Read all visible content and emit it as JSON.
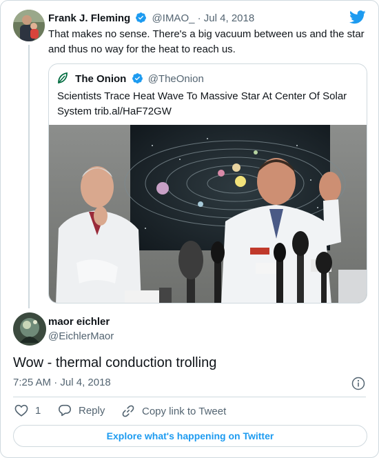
{
  "parent_tweet": {
    "author_name": "Frank J. Fleming",
    "handle": "@IMAO_",
    "separator": "·",
    "date": "Jul 4, 2018",
    "text": "That makes no sense. There's a big vacuum between us and the star and thus no way for the heat to reach us.",
    "avatar_icon": "person-with-child-photo"
  },
  "quoted_tweet": {
    "author_name": "The Onion",
    "handle": "@TheOnion",
    "text": "Scientists Trace Heat Wave To Massive Star At Center Of Solar System trib.al/HaF72GW",
    "logo_icon": "onion-leaf-icon",
    "image_description_icon": "scientists-press-conference-photo"
  },
  "reply_tweet": {
    "author_name": "maor eichler",
    "handle": "@EichlerMaor",
    "text": "Wow - thermal conduction trolling",
    "time": "7:25 AM",
    "separator": "·",
    "date": "Jul 4, 2018",
    "avatar_icon": "avatar-photo"
  },
  "actions": {
    "like_count": "1",
    "reply_label": "Reply",
    "copy_label": "Copy link to Tweet"
  },
  "explore_label": "Explore what's happening on Twitter",
  "colors": {
    "accent": "#1d9bf0",
    "text": "#0f1419",
    "muted": "#536471",
    "border": "#cfd9de",
    "onion_green": "#006b3f"
  }
}
